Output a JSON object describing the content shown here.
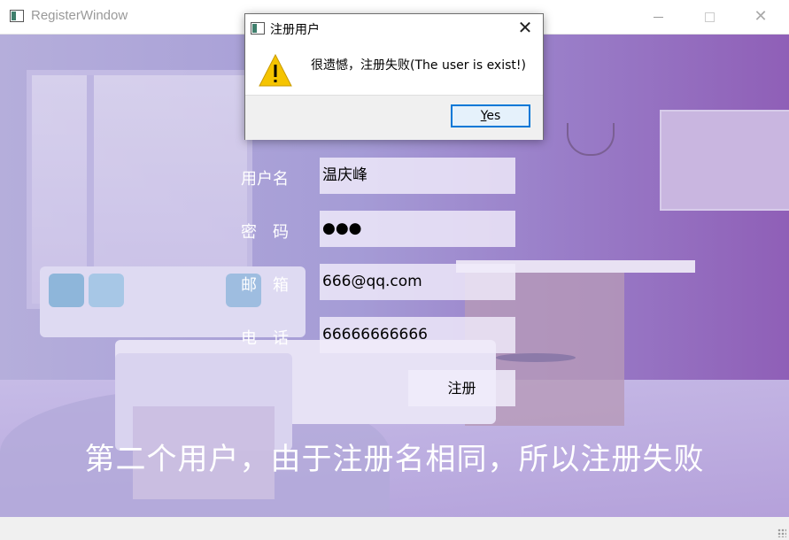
{
  "window": {
    "title": "RegisterWindow",
    "min_icon": "minimize-icon",
    "max_icon": "maximize-icon",
    "close_glyph": "✕"
  },
  "form": {
    "username_label": "用户名",
    "password_label": "密　码",
    "email_label": "邮　箱",
    "phone_label": "电　话",
    "username_value": "温庆峰",
    "password_value": "●●●",
    "email_value": "666@qq.com",
    "phone_value": "66666666666",
    "register_button": "注册"
  },
  "caption": "第二个用户，由于注册名相同，所以注册失败",
  "dialog": {
    "title": "注册用户",
    "message": "很遗憾，注册失败(The user is exist!)",
    "yes_label_mnemonic": "Y",
    "yes_label_rest": "es",
    "close_glyph": "✕",
    "icon": "warning-icon"
  },
  "colors": {
    "accent": "#0078d7",
    "warning": "#f5c400"
  }
}
